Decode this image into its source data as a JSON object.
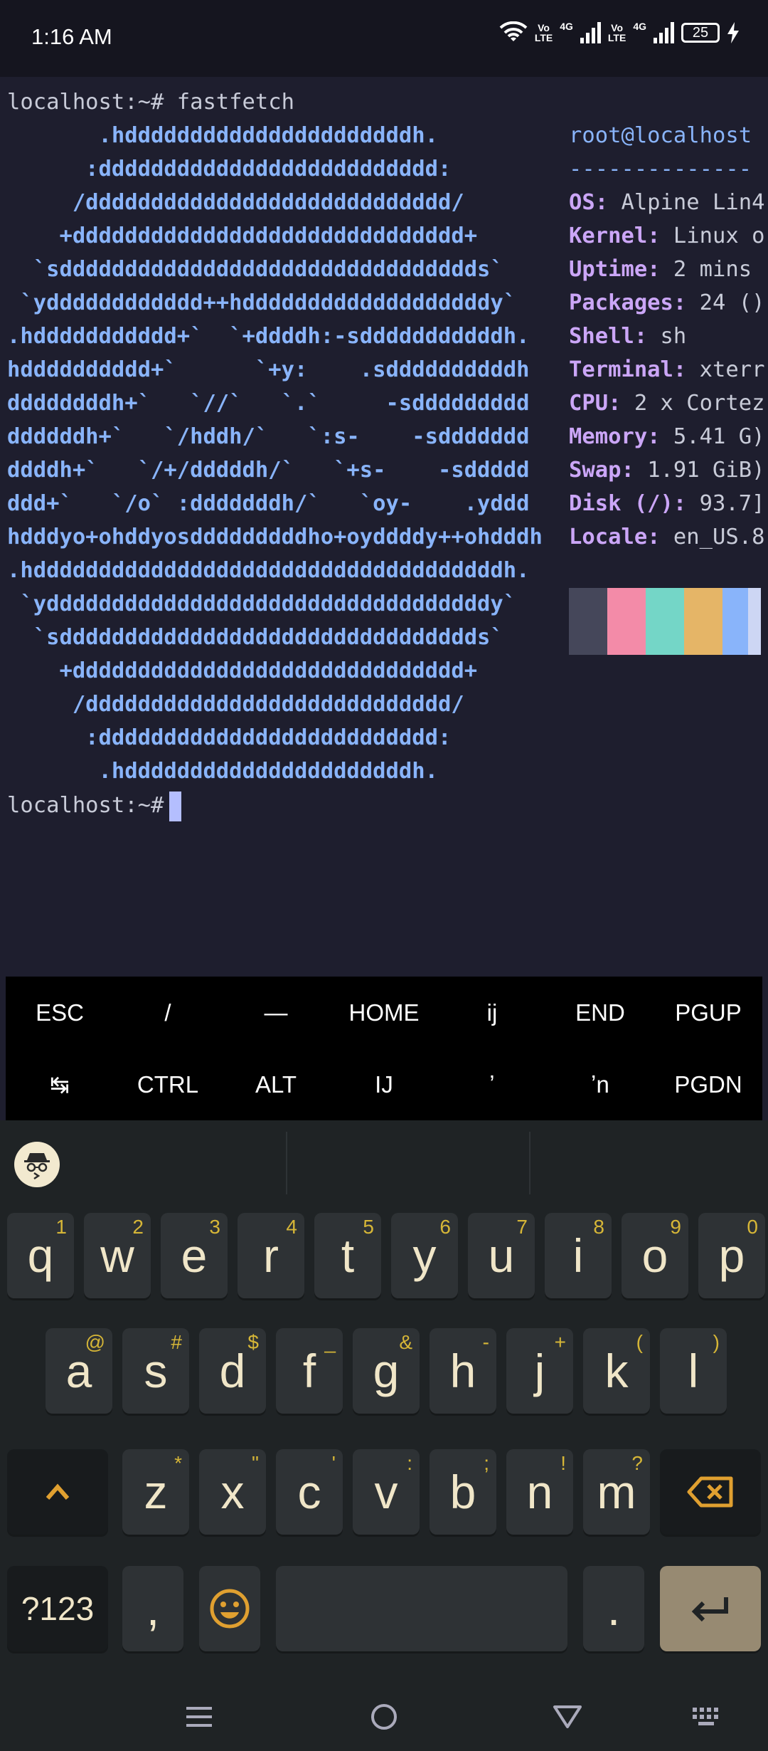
{
  "status_bar": {
    "time": "1:16 AM",
    "sim1_label_top": "Vo",
    "sim1_label_bottom": "LTE",
    "sim1_net": "4G",
    "sim2_label_top": "Vo",
    "sim2_label_bottom": "LTE",
    "sim2_net": "4G",
    "battery": "25",
    "icons": [
      "wifi-icon",
      "signal-icon",
      "battery-icon",
      "charging-icon"
    ]
  },
  "terminal": {
    "command_line": "localhost:~# fastfetch",
    "logo_lines": [
      "       .hddddddddddddddddddddddh.",
      "      :dddddddddddddddddddddddddd:",
      "     /dddddddddddddddddddddddddddd/",
      "    +dddddddddddddddddddddddddddddd+",
      "  `sdddddddddddddddddddddddddddddddds`",
      " `ydddddddddddd++hdddddddddddddddddddy`",
      ".hddddddddddd+`  `+ddddh:-sdddddddddddh.",
      "hdddddddddd+`      `+y:    .sddddddddddh",
      "ddddddddh+`   `//`   `.`     -sddddddddd",
      "ddddddh+`   `/hddh/`   `:s-    -sddddddd",
      "ddddh+`   `/+/dddddh/`   `+s-    -sddddd",
      "ddd+`   `/o` :dddddddh/`   `oy-    .yddd",
      "hdddyo+ohddyosdddddddddho+oyddddy++ohdddh",
      ".hddddddddddddddddddddddddddddddddddddh.",
      " `yddddddddddddddddddddddddddddddddddy`",
      "  `sdddddddddddddddddddddddddddddddds`",
      "    +dddddddddddddddddddddddddddddd+",
      "     /dddddddddddddddddddddddddddd/",
      "      :dddddddddddddddddddddddddd:",
      "       .hddddddddddddddddddddddh."
    ],
    "user_host": "root@localhost",
    "separator": "--------------",
    "info": [
      {
        "key": "OS:",
        "value": " Alpine Lin4"
      },
      {
        "key": "Kernel:",
        "value": " Linux o"
      },
      {
        "key": "Uptime:",
        "value": " 2 mins"
      },
      {
        "key": "Packages:",
        "value": " 24 ()"
      },
      {
        "key": "Shell:",
        "value": " sh"
      },
      {
        "key": "Terminal:",
        "value": " xterr"
      },
      {
        "key": "CPU:",
        "value": " 2 x Cortez"
      },
      {
        "key": "Memory:",
        "value": " 5.41 G)"
      },
      {
        "key": "Swap:",
        "value": " 1.91 GiB)"
      },
      {
        "key": "Disk (/):",
        "value": " 93.7]"
      },
      {
        "key": "Locale:",
        "value": " en_US.8"
      }
    ],
    "palette": [
      "#45475a",
      "#f38ba8",
      "#74d6c7",
      "#e5b567",
      "#89b4fa",
      "#cdd6f4"
    ],
    "prompt": "localhost:~#"
  },
  "extra_keys": {
    "row1": [
      "ESC",
      "/",
      "—",
      "HOME",
      "ij",
      "END",
      "PGUP"
    ],
    "row2": [
      "↹",
      "CTRL",
      "ALT",
      "IJ",
      "ʼ",
      "ʼn",
      "PGDN"
    ]
  },
  "keyboard": {
    "row1": [
      {
        "label": "q",
        "hint": "1"
      },
      {
        "label": "w",
        "hint": "2"
      },
      {
        "label": "e",
        "hint": "3"
      },
      {
        "label": "r",
        "hint": "4"
      },
      {
        "label": "t",
        "hint": "5"
      },
      {
        "label": "y",
        "hint": "6"
      },
      {
        "label": "u",
        "hint": "7"
      },
      {
        "label": "i",
        "hint": "8"
      },
      {
        "label": "o",
        "hint": "9"
      },
      {
        "label": "p",
        "hint": "0"
      }
    ],
    "row2": [
      {
        "label": "a",
        "hint": "@"
      },
      {
        "label": "s",
        "hint": "#"
      },
      {
        "label": "d",
        "hint": "$"
      },
      {
        "label": "f",
        "hint": "_"
      },
      {
        "label": "g",
        "hint": "&"
      },
      {
        "label": "h",
        "hint": "-"
      },
      {
        "label": "j",
        "hint": "+"
      },
      {
        "label": "k",
        "hint": "("
      },
      {
        "label": "l",
        "hint": ")"
      }
    ],
    "row3": [
      {
        "label": "z",
        "hint": "*"
      },
      {
        "label": "x",
        "hint": "\""
      },
      {
        "label": "c",
        "hint": "'"
      },
      {
        "label": "v",
        "hint": ":"
      },
      {
        "label": "b",
        "hint": ";"
      },
      {
        "label": "n",
        "hint": "!"
      },
      {
        "label": "m",
        "hint": "?"
      }
    ],
    "symbols_label": "?123",
    "comma_label": ",",
    "period_label": ".",
    "shift_icon": "shift-icon",
    "backspace_icon": "backspace-icon",
    "emoji_icon": "emoji-icon",
    "enter_icon": "enter-icon",
    "incognito_icon": "incognito-icon"
  },
  "nav_bar": [
    "menu-icon",
    "home-icon",
    "back-icon",
    "keyboard-switch-icon"
  ]
}
